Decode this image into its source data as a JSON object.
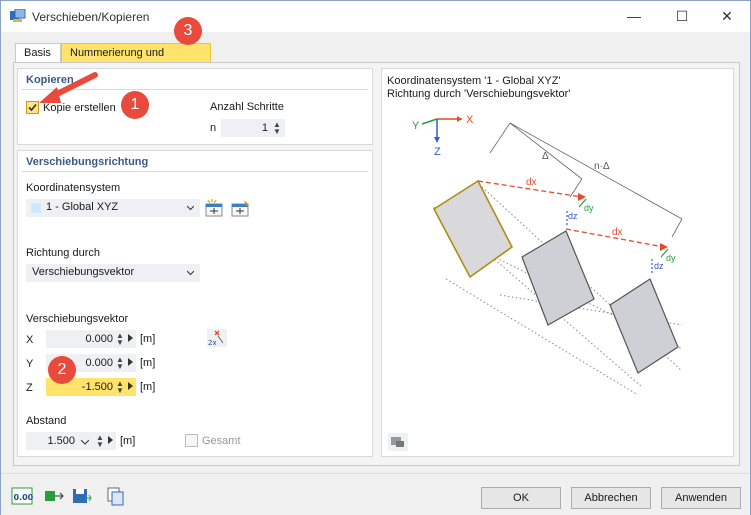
{
  "window": {
    "title": "Verschieben/Kopieren",
    "minimize": "—",
    "maximize": "☐",
    "close": "✕"
  },
  "tabs": {
    "basis": "Basis",
    "numbering": "Nummerierung und Optionen"
  },
  "copy": {
    "section": "Kopieren",
    "checkbox_label": "Kopie erstellen",
    "checked": true,
    "steps_label": "Anzahl Schritte",
    "steps_prefix": "n",
    "steps_value": "1"
  },
  "shift": {
    "section": "Verschiebungsrichtung",
    "coord_label": "Koordinatensystem",
    "coord_value": "1 - Global XYZ",
    "dir_label": "Richtung durch",
    "dir_value": "Verschiebungsvektor",
    "vector_label": "Verschiebungsvektor",
    "x_label": "X",
    "x_value": "0.000",
    "x_unit": "[m]",
    "y_label": "Y",
    "y_value": "0.000",
    "y_unit": "[m]",
    "z_label": "Z",
    "z_value": "-1.500",
    "z_unit": "[m]",
    "distance_label": "Abstand",
    "distance_value": "1.500",
    "distance_unit": "[m]",
    "total_label": "Gesamt"
  },
  "preview": {
    "line1": "Koordinatensystem '1 - Global XYZ'",
    "line2": "Richtung durch 'Verschiebungsvektor'",
    "axis_x": "X",
    "axis_y": "Y",
    "axis_z": "Z",
    "delta": "Δ",
    "ndelta": "n·Δ",
    "dx": "dx",
    "dy": "dy",
    "dz": "dz"
  },
  "badges": {
    "b1": "1",
    "b2": "2",
    "b3": "3"
  },
  "footer": {
    "ok": "OK",
    "cancel": "Abbrechen",
    "apply": "Anwenden",
    "units": "0.00"
  },
  "colors": {
    "accent_yellow": "#ffe36a",
    "badge_red": "#e84a3c",
    "section_blue": "#3a5a86",
    "dx_red": "#e24a2a"
  },
  "icons": [
    "app-icon",
    "new-coordinate-system-icon",
    "edit-coordinate-system-icon",
    "pick-vector-icon",
    "preview-settings-icon",
    "units-icon",
    "model-icon",
    "save-icon",
    "copy-icon"
  ]
}
